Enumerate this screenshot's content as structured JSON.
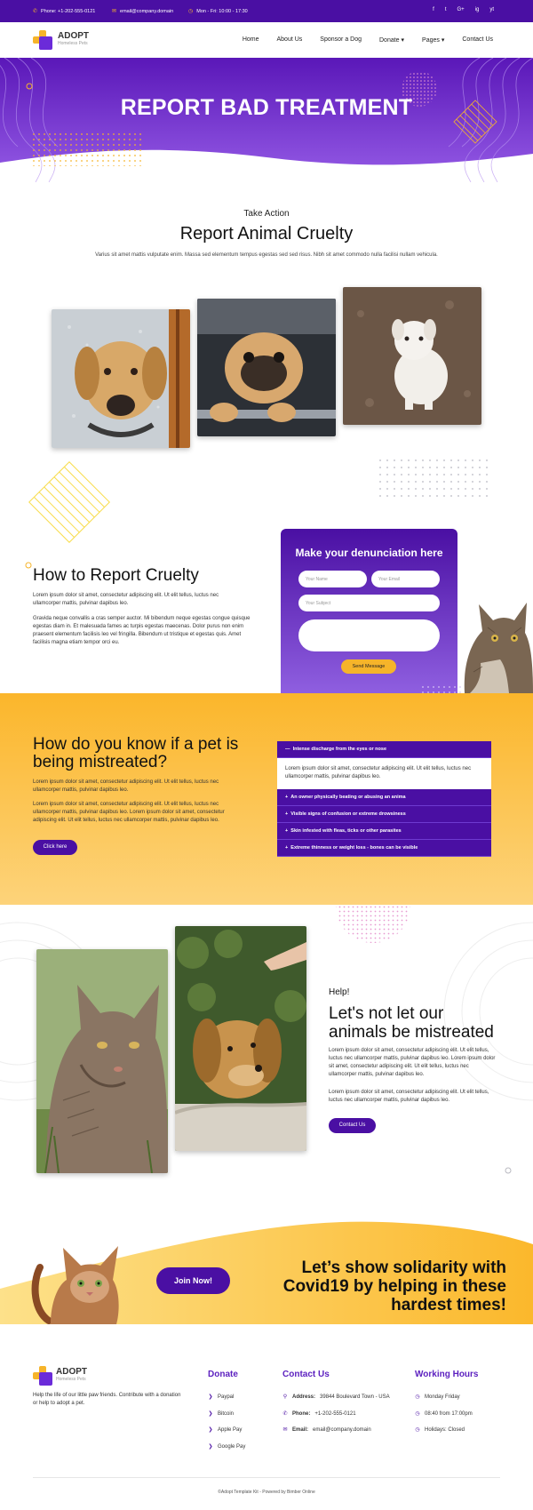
{
  "topbar": {
    "phone": "Phone: +1-202-555-0121",
    "email": "email@company.domain",
    "hours": "Mon - Fri: 10:00 - 17:30",
    "social": [
      "f",
      "t",
      "G+",
      "ig",
      "yt"
    ]
  },
  "brand": {
    "name": "ADOPT",
    "tagline": "Homeless Pets"
  },
  "nav": {
    "items": [
      "Home",
      "About Us",
      "Sponsor a Dog",
      "Donate",
      "Pages",
      "Contact Us"
    ],
    "dropdown_marker": "▾"
  },
  "hero": {
    "title": "REPORT BAD TREATMENT"
  },
  "intro": {
    "kicker": "Take Action",
    "title": "Report Animal Cruelty",
    "text": "Varius sit amet mattis vulputate enim. Massa sed elementum tempus egestas sed sed risus. Nibh sit amet commodo nulla facilisi nullam vehicula."
  },
  "how": {
    "title": "How to Report Cruelty",
    "p1": "Lorem ipsum dolor sit amet, consectetur adipiscing elit. Ut elit tellus, luctus nec ullamcorper mattis, pulvinar dapibus leo.",
    "p2": "Gravida neque convallis a cras semper auctor. Mi bibendum neque egestas congue quisque egestas diam in. Et malesuada fames ac turpis egestas maecenas. Dolor purus non enim praesent elementum facilisis leo vel fringilla. Bibendum ut tristique et egestas quis. Amet facilisis magna etiam tempor orci eu."
  },
  "form": {
    "title": "Make your denunciation here",
    "name_placeholder": "Your Name",
    "email_placeholder": "Your Email",
    "subject_placeholder": "Your Subject",
    "message_placeholder": "",
    "button": "Send Message"
  },
  "mistreated": {
    "title": "How do you know if a pet is being mistreated?",
    "p1": "Lorem ipsum dolor sit amet, consectetur adipiscing elit. Ut elit tellus, luctus nec ullamcorper mattis, pulvinar dapibus leo.",
    "p2": "Lorem ipsum dolor sit amet, consectetur adipiscing elit. Ut elit tellus, luctus nec ullamcorper mattis, pulvinar dapibus leo. Lorem ipsum dolor sit amet, consectetur adipiscing elit. Ut elit tellus, luctus nec ullamcorper mattis, pulvinar dapibus leo.",
    "button": "Click here",
    "accordion": [
      {
        "title": "Intense discharge from the eyes or nose",
        "open": true,
        "marker": "—",
        "body": "Lorem ipsum dolor sit amet, consectetur adipiscing elit. Ut elit tellus, luctus nec ullamcorper mattis, pulvinar dapibus leo."
      },
      {
        "title": "An owner physically beating or abusing an anima",
        "open": false,
        "marker": "+"
      },
      {
        "title": "Visible signs of confusion or extreme drowsiness",
        "open": false,
        "marker": "+"
      },
      {
        "title": "Skin infested with fleas, ticks or other parasites",
        "open": false,
        "marker": "+"
      },
      {
        "title": "Extreme thinness or weight loss - bones can be visible",
        "open": false,
        "marker": "+"
      }
    ]
  },
  "help": {
    "kicker": "Help!",
    "title": "Let's not let our animals be mistreated",
    "p1": "Lorem ipsum dolor sit amet, consectetur adipiscing elit. Ut elit tellus, luctus nec ullamcorper mattis, pulvinar dapibus leo. Lorem ipsum dolor sit amet, consectetur adipiscing elit. Ut elit tellus, luctus nec ullamcorper mattis, pulvinar dapibus leo.",
    "p2": "Lorem ipsum dolor sit amet, consectetur adipiscing elit. Ut elit tellus, luctus nec ullamcorper mattis, pulvinar dapibus leo.",
    "button": "Contact Us"
  },
  "covid": {
    "button": "Join Now!",
    "text": "Let’s show solidarity with Covid19 by helping in these hardest times!"
  },
  "footer": {
    "about": "Help the life of our little paw friends. Contribute with a donation or help to adopt a pet.",
    "donate": {
      "title": "Donate",
      "items": [
        "Paypal",
        "Bitcoin",
        "Apple Pay",
        "Google Pay"
      ]
    },
    "contact": {
      "title": "Contact Us",
      "address_label": "Address:",
      "address": "39844 Boulevard Town - USA",
      "phone_label": "Phone:",
      "phone": "+1-202-555-0121",
      "email_label": "Email:",
      "email": "email@company.domain"
    },
    "hours": {
      "title": "Working Hours",
      "items": [
        "Monday Friday",
        "08:40 from 17:00pm",
        "Holidays: Closed"
      ]
    },
    "copyright": "©Adopt Template Kit - Powered by Bimber Online"
  },
  "colors": {
    "primary": "#4a0fa3",
    "accent": "#f6b42a",
    "heading_purple": "#5b1fbf"
  }
}
